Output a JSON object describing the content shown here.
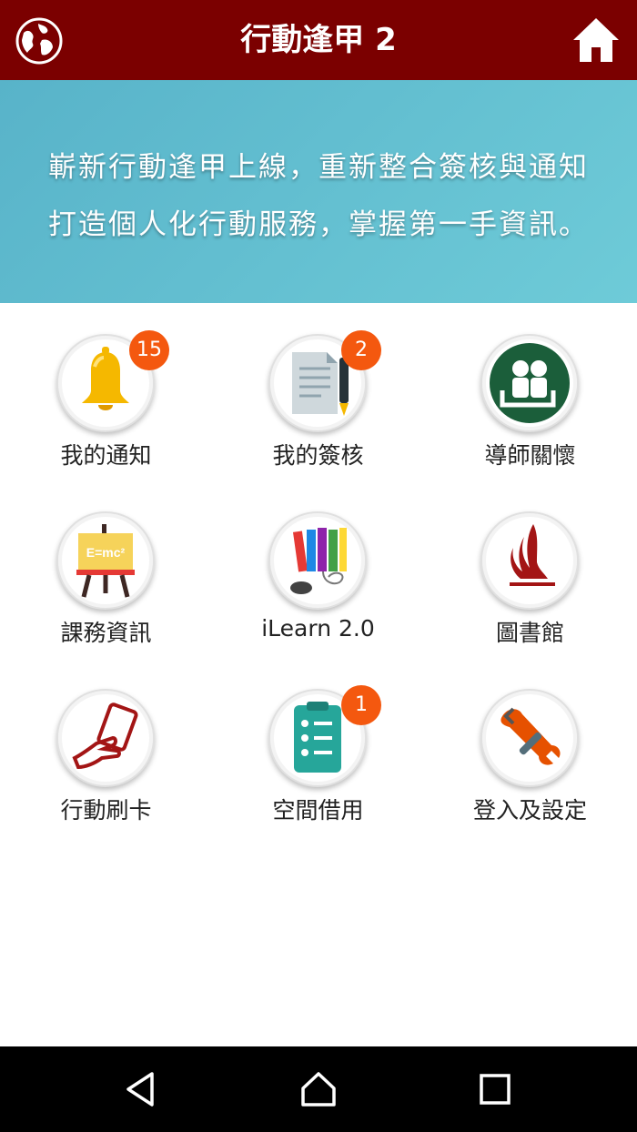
{
  "app_bar": {
    "title": "行動逢甲 2",
    "left_icon": "globe-icon",
    "right_icon": "home-icon",
    "background": "#7b0000"
  },
  "banner": {
    "line1": "嶄新行動逢甲上線，重新整合簽核與通知",
    "line2": "打造個人化行動服務，掌握第一手資訊。"
  },
  "tiles": [
    {
      "label": "我的通知",
      "icon": "bell-icon",
      "badge": "15"
    },
    {
      "label": "我的簽核",
      "icon": "document-pen-icon",
      "badge": "2"
    },
    {
      "label": "導師關懷",
      "icon": "people-care-icon",
      "badge": ""
    },
    {
      "label": "課務資訊",
      "icon": "easel-board-icon",
      "badge": ""
    },
    {
      "label": "iLearn 2.0",
      "icon": "books-mouse-icon",
      "badge": ""
    },
    {
      "label": "圖書館",
      "icon": "library-logo-icon",
      "badge": ""
    },
    {
      "label": "行動刷卡",
      "icon": "hand-card-icon",
      "badge": ""
    },
    {
      "label": "空間借用",
      "icon": "checklist-icon",
      "badge": "1"
    },
    {
      "label": "登入及設定",
      "icon": "wrench-settings-icon",
      "badge": ""
    }
  ],
  "easel_text": "E=mc²",
  "colors": {
    "badge": "#f4580f",
    "banner": "#5fbfd0",
    "nav_bar": "#000000"
  },
  "nav_bar": {
    "buttons": [
      "back-icon",
      "home-nav-icon",
      "recents-icon"
    ]
  }
}
